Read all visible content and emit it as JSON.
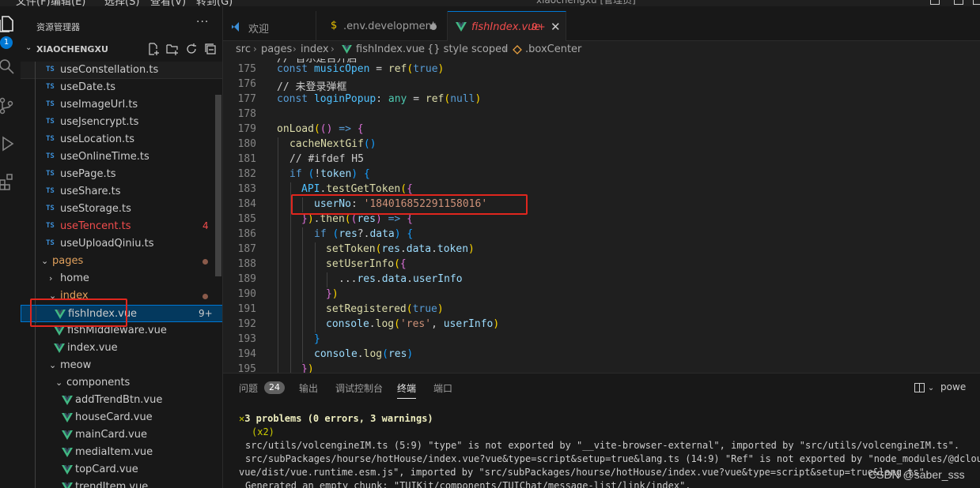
{
  "window": {
    "title": "xiaochengxu [管理员]",
    "menu": [
      "文件(F)",
      "编辑(E)",
      "选择(S)",
      "查看(V)",
      "转到(G)"
    ]
  },
  "activity_bar": {
    "badge": "1",
    "icons": [
      "explorer-icon",
      "search-icon",
      "source-control-icon",
      "run-debug-icon",
      "extensions-icon"
    ]
  },
  "sidebar": {
    "title": "资源管理器",
    "more": "···",
    "root": "XIAOCHENGXU",
    "root_chevron": "⌄",
    "tree": [
      {
        "label": "useConstellation.ts",
        "icon": "TS",
        "pinned": true
      },
      {
        "label": "useDate.ts",
        "icon": "TS"
      },
      {
        "label": "useImageUrl.ts",
        "icon": "TS"
      },
      {
        "label": "useJsencrypt.ts",
        "icon": "TS"
      },
      {
        "label": "useLocation.ts",
        "icon": "TS"
      },
      {
        "label": "useOnlineTime.ts",
        "icon": "TS"
      },
      {
        "label": "usePage.ts",
        "icon": "TS"
      },
      {
        "label": "useShare.ts",
        "icon": "TS"
      },
      {
        "label": "useStorage.ts",
        "icon": "TS"
      },
      {
        "label": "useTencent.ts",
        "icon": "TS",
        "count": "4"
      },
      {
        "label": "useUploadQiniu.ts",
        "icon": "TS"
      },
      {
        "label": "pages",
        "chevron": "⌄"
      },
      {
        "label": "home",
        "chevron": "›"
      },
      {
        "label": "index",
        "chevron": "⌄"
      },
      {
        "label": "fishIndex.vue",
        "icon": "vue",
        "count": "9+"
      },
      {
        "label": "fishMiddleware.vue",
        "icon": "vue"
      },
      {
        "label": "index.vue",
        "icon": "vue"
      },
      {
        "label": "meow",
        "chevron": "⌄"
      },
      {
        "label": "components",
        "chevron": "⌄"
      },
      {
        "label": "addTrendBtn.vue",
        "icon": "vue"
      },
      {
        "label": "houseCard.vue",
        "icon": "vue"
      },
      {
        "label": "mainCard.vue",
        "icon": "vue"
      },
      {
        "label": "mediaItem.vue",
        "icon": "vue"
      },
      {
        "label": "topCard.vue",
        "icon": "vue"
      },
      {
        "label": "trendItem.vue",
        "icon": "vue"
      }
    ]
  },
  "tabs": [
    {
      "label": "欢迎",
      "icon": "vscode-icon"
    },
    {
      "label": ".env.development",
      "icon": "dollar-icon",
      "modified": true
    },
    {
      "label": "fishIndex.vue",
      "icon": "vue-icon",
      "count": "9+",
      "close": "✕",
      "active": true
    }
  ],
  "breadcrumb": [
    "src",
    "pages",
    "index",
    "fishIndex.vue",
    "{} style scoped",
    ".boxCenter"
  ],
  "breadcrumb_sep": "›",
  "code": {
    "lines": [
      {
        "n": "175"
      },
      {
        "n": "176"
      },
      {
        "n": "177"
      },
      {
        "n": "178"
      },
      {
        "n": "179"
      },
      {
        "n": "180"
      },
      {
        "n": "181"
      },
      {
        "n": "182"
      },
      {
        "n": "183"
      },
      {
        "n": "184"
      },
      {
        "n": "185"
      },
      {
        "n": "186"
      },
      {
        "n": "187"
      },
      {
        "n": "188"
      },
      {
        "n": "189"
      },
      {
        "n": "190"
      },
      {
        "n": "191"
      },
      {
        "n": "192"
      },
      {
        "n": "193"
      },
      {
        "n": "194"
      },
      {
        "n": "195"
      }
    ],
    "top_partial": "// 音乐是否开启",
    "line_175": "const musicOpen = ref(true)",
    "line_176": "// 未登录弹框",
    "line_177": "const loginPopup: any = ref(null)",
    "line_179": "onLoad(() => {",
    "line_180": "cacheNextGif()",
    "line_181": "// #ifdef H5",
    "line_182": "if (!token) {",
    "line_183": "API.testGetToken({",
    "line_184_key": "userNo",
    "line_184_value": "'184016852291158016'",
    "line_185": "}).then((res) => {",
    "line_186": "if (res?.data) {",
    "line_187": "setToken(res.data.token)",
    "line_188": "setUserInfo({",
    "line_189": "...res.data.userInfo",
    "line_190": "})",
    "line_191": "setRegistered(true)",
    "line_192": "console.log('res', userInfo)",
    "line_193": "}",
    "line_194": "console.log(res)",
    "line_195": "})"
  },
  "panel": {
    "tabs": [
      "问题",
      "输出",
      "调试控制台",
      "终端",
      "端口"
    ],
    "problem_count": "24",
    "active_tab": "终端",
    "right": "powe",
    "terminal": [
      "3 problems (0 errors, 3 warnings)",
      "(x2)",
      "src/utils/volcengineIM.ts (5:9) \"type\" is not exported by \"__vite-browser-external\", imported by \"src/utils/volcengineIM.ts\".",
      "src/subPackages/hourse/hotHouse/index.vue?vue&type=script&setup=true&lang.ts (14:9) \"Ref\" is not exported by \"node_modules/@dcloudio/",
      "vue/dist/vue.runtime.esm.js\", imported by \"src/subPackages/hourse/hotHouse/index.vue?vue&type=script&setup=true&lang.ts\".",
      "Generated an empty chunk: \"TUIKit/components/TUIChat/message-list/link/index\"."
    ],
    "warn_mark": "✕",
    "watermark": "CSDN @saber_sss"
  },
  "colors": {
    "accent": "#0078d4",
    "highlight_box": "#e0261e",
    "error": "#f14c4c"
  }
}
